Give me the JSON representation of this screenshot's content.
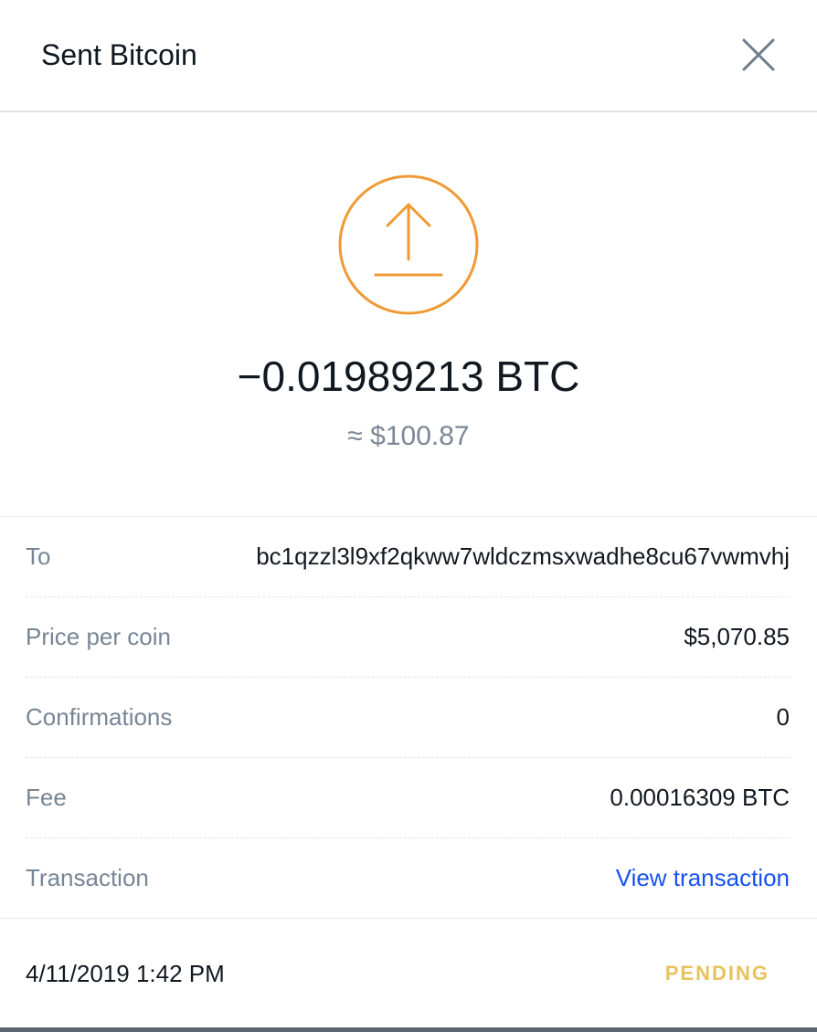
{
  "header": {
    "title": "Sent Bitcoin",
    "close_icon": "close-icon"
  },
  "hero": {
    "icon": "send-arrow-icon",
    "amount": "−0.01989213 BTC",
    "fiat_value": "≈ $100.87"
  },
  "details": {
    "rows": [
      {
        "label": "To",
        "value": "bc1qzzl3l9xf2qkww7wldczmsxwadhe8cu67vwmvhj"
      },
      {
        "label": "Price per coin",
        "value": "$5,070.85"
      },
      {
        "label": "Confirmations",
        "value": "0"
      },
      {
        "label": "Fee",
        "value": "0.00016309 BTC"
      },
      {
        "label": "Transaction",
        "value": "View transaction"
      }
    ]
  },
  "footer": {
    "date": "4/11/2019 1:42 PM",
    "status": "PENDING"
  },
  "colors": {
    "accent_orange": "#ef9a34",
    "link_blue": "#1652f0",
    "pending_yellow": "#e8c25c",
    "muted_gray": "#788594"
  }
}
